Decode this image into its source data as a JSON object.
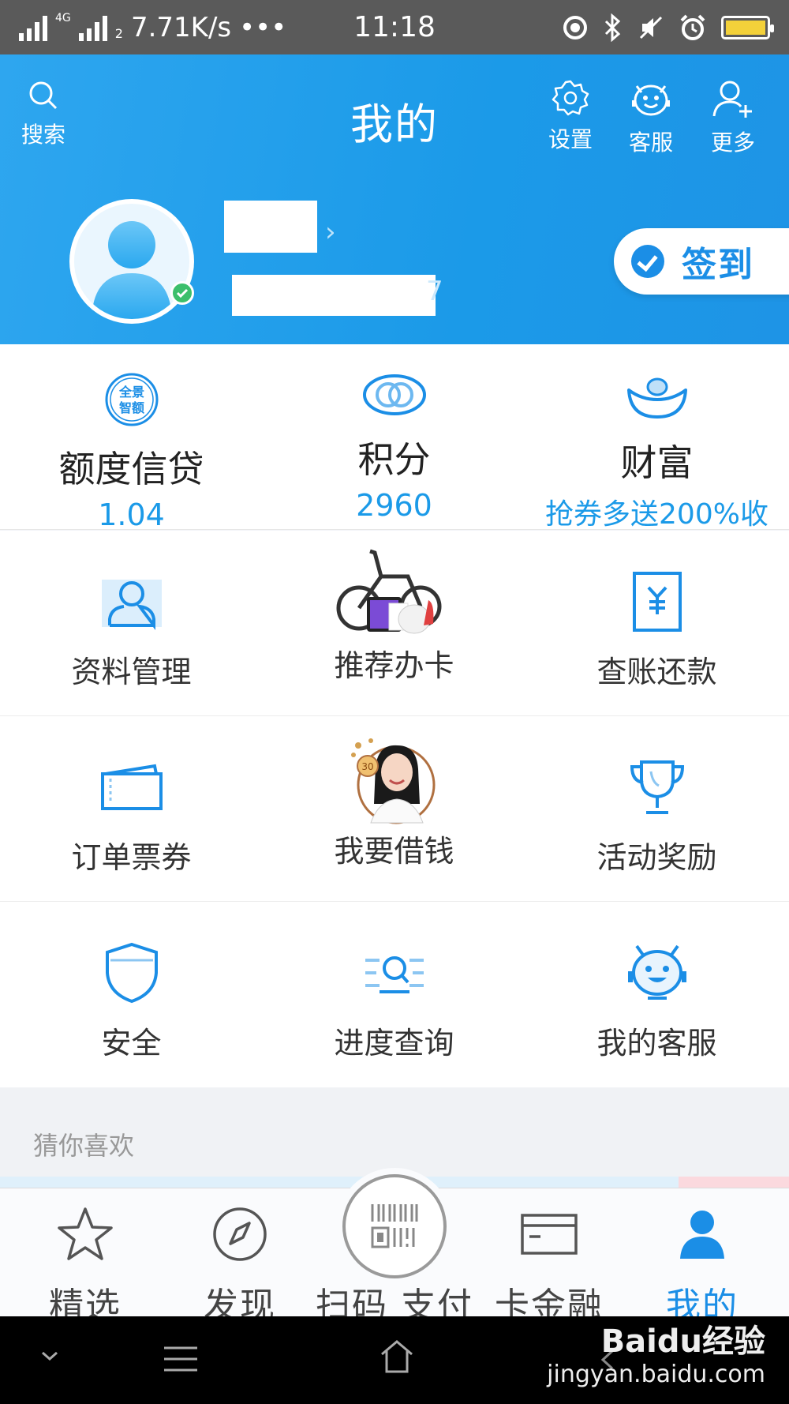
{
  "status_bar": {
    "network": "4G",
    "sim": "2",
    "speed": "7.71K/s",
    "more": "•••",
    "time": "11:18",
    "battery_color": "#f3d13a"
  },
  "header": {
    "title": "我的",
    "search_label": "搜索",
    "settings_label": "设置",
    "service_label": "客服",
    "more_label": "更多",
    "checkin_label": "签到",
    "account_tail": "7",
    "bg_color": "#1b9ae8"
  },
  "stats": [
    {
      "label": "额度信贷",
      "value": "1.04",
      "icon": "quota-icon",
      "badge": "全景\n智额"
    },
    {
      "label": "积分",
      "value": "2960",
      "icon": "points-icon"
    },
    {
      "label": "财富",
      "value": "抢券多送200%收",
      "icon": "wealth-ingot-icon"
    }
  ],
  "grid": [
    [
      {
        "label": "资料管理",
        "icon": "profile-icon"
      },
      {
        "label": "推荐办卡",
        "icon": "recommend-card-image"
      },
      {
        "label": "查账还款",
        "icon": "bill-repay-icon"
      }
    ],
    [
      {
        "label": "订单票券",
        "icon": "ticket-icon"
      },
      {
        "label": "我要借钱",
        "icon": "borrow-money-image"
      },
      {
        "label": "活动奖励",
        "icon": "trophy-icon"
      }
    ],
    [
      {
        "label": "安全",
        "icon": "shield-icon"
      },
      {
        "label": "进度查询",
        "icon": "progress-search-icon"
      },
      {
        "label": "我的客服",
        "icon": "customer-service-icon"
      }
    ]
  ],
  "guess": {
    "title": "猜你喜欢"
  },
  "tabbar": [
    {
      "label": "精选",
      "icon": "star-icon",
      "active": false
    },
    {
      "label": "发现",
      "icon": "compass-icon",
      "active": false
    },
    {
      "label": "扫码 支付",
      "icon": "scan-pay-icon",
      "active": false
    },
    {
      "label": "卡金融",
      "icon": "card-icon",
      "active": false
    },
    {
      "label": "我的",
      "icon": "person-icon",
      "active": true
    }
  ],
  "watermark": {
    "brand": "Baidu经验",
    "url": "jingyan.baidu.com"
  },
  "accent_color": "#1b8ee6"
}
